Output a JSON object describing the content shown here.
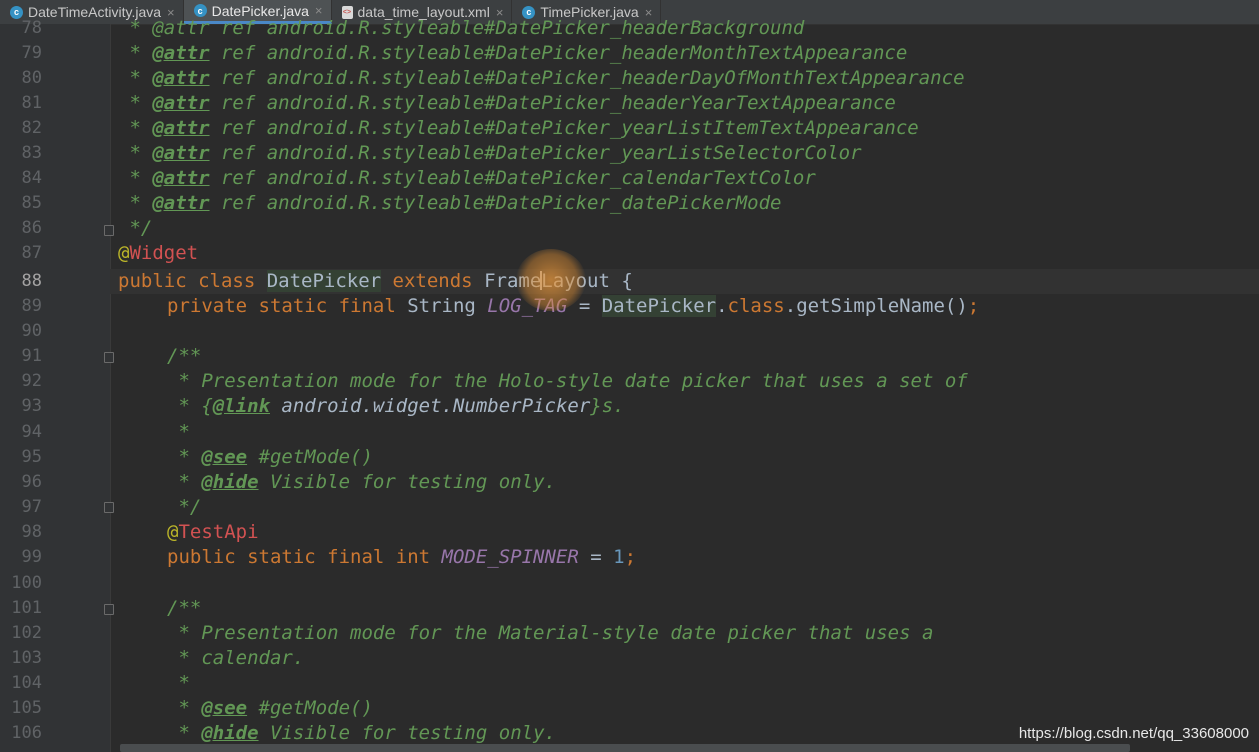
{
  "tabs": [
    {
      "label": "DateTimeActivity.java",
      "icon": "java-class-icon",
      "active": false
    },
    {
      "label": "DatePicker.java",
      "icon": "java-class-icon",
      "active": true
    },
    {
      "label": "data_time_layout.xml",
      "icon": "xml-file-icon",
      "active": false
    },
    {
      "label": "TimePicker.java",
      "icon": "java-class-icon",
      "active": false
    }
  ],
  "line_numbers": [
    "78",
    "79",
    "80",
    "81",
    "82",
    "83",
    "84",
    "85",
    "86",
    "87",
    "88",
    "89",
    "90",
    "91",
    "92",
    "93",
    "94",
    "95",
    "96",
    "97",
    "98",
    "99",
    "100",
    "101",
    "102",
    "103",
    "104",
    "105",
    "106"
  ],
  "current_line": "88",
  "code": {
    "l78": " * @attr ref android.R.styleable#DatePicker_headerBackground",
    "l79_tag": "@attr",
    "l79_rest": " ref android.R.styleable#DatePicker_headerMonthTextAppearance",
    "l80_tag": "@attr",
    "l80_rest": " ref android.R.styleable#DatePicker_headerDayOfMonthTextAppearance",
    "l81_tag": "@attr",
    "l81_rest": " ref android.R.styleable#DatePicker_headerYearTextAppearance",
    "l82_tag": "@attr",
    "l82_rest": " ref android.R.styleable#DatePicker_yearListItemTextAppearance",
    "l83_tag": "@attr",
    "l83_rest": " ref android.R.styleable#DatePicker_yearListSelectorColor",
    "l84_tag": "@attr",
    "l84_rest": " ref android.R.styleable#DatePicker_calendarTextColor",
    "l85_tag": "@attr",
    "l85_rest": " ref android.R.styleable#DatePicker_datePickerMode",
    "l86": " */",
    "l87_at": "@",
    "l87_name": "Widget",
    "l88_kw": "public class ",
    "l88_cls": "DatePicker",
    "l88_kw2": " extends ",
    "l88_sup_a": "Frame",
    "l88_sup_b": "Layout",
    "l88_rest": " {",
    "l89_kw": "private static final ",
    "l89_type": "String ",
    "l89_field": "LOG_TAG",
    "l89_eq": " = ",
    "l89_cls": "DatePicker",
    "l89_dot": ".",
    "l89_kw2": "class",
    "l89_call": ".getSimpleName()",
    "l89_semi": ";",
    "l91": "/**",
    "l92": " * Presentation mode for the Holo-style date picker that uses a set of",
    "l93_pre": " * {",
    "l93_tag": "@link",
    "l93_mid": " android.widget.NumberPicker",
    "l93_post": "}s.",
    "l94": " *",
    "l95_pre": " * ",
    "l95_tag": "@see",
    "l95_rest": " #getMode()",
    "l96_pre": " * ",
    "l96_tag": "@hide",
    "l96_rest": " Visible for testing only.",
    "l97": " */",
    "l98_at": "@",
    "l98_name": "TestApi",
    "l99_kw": "public static final int ",
    "l99_field": "MODE_SPINNER",
    "l99_eq": " = ",
    "l99_num": "1",
    "l99_semi": ";",
    "l101": "/**",
    "l102": " * Presentation mode for the Material-style date picker that uses a",
    "l103": " * calendar.",
    "l104": " *",
    "l105_pre": " * ",
    "l105_tag": "@see",
    "l105_rest": " #getMode()",
    "l106_pre": " * ",
    "l106_tag": "@hide",
    "l106_rest": " Visible for testing only.",
    "star": " * "
  },
  "watermark": "https://blog.csdn.net/qq_33608000",
  "colors": {
    "background": "#2b2b2b",
    "keyword": "#cc7832",
    "javadoc": "#629755",
    "annotation": "#bbb529",
    "static_field": "#9876aa",
    "number": "#6897bb",
    "text": "#a9b7c6",
    "tab_accent": "#4a88c7"
  }
}
